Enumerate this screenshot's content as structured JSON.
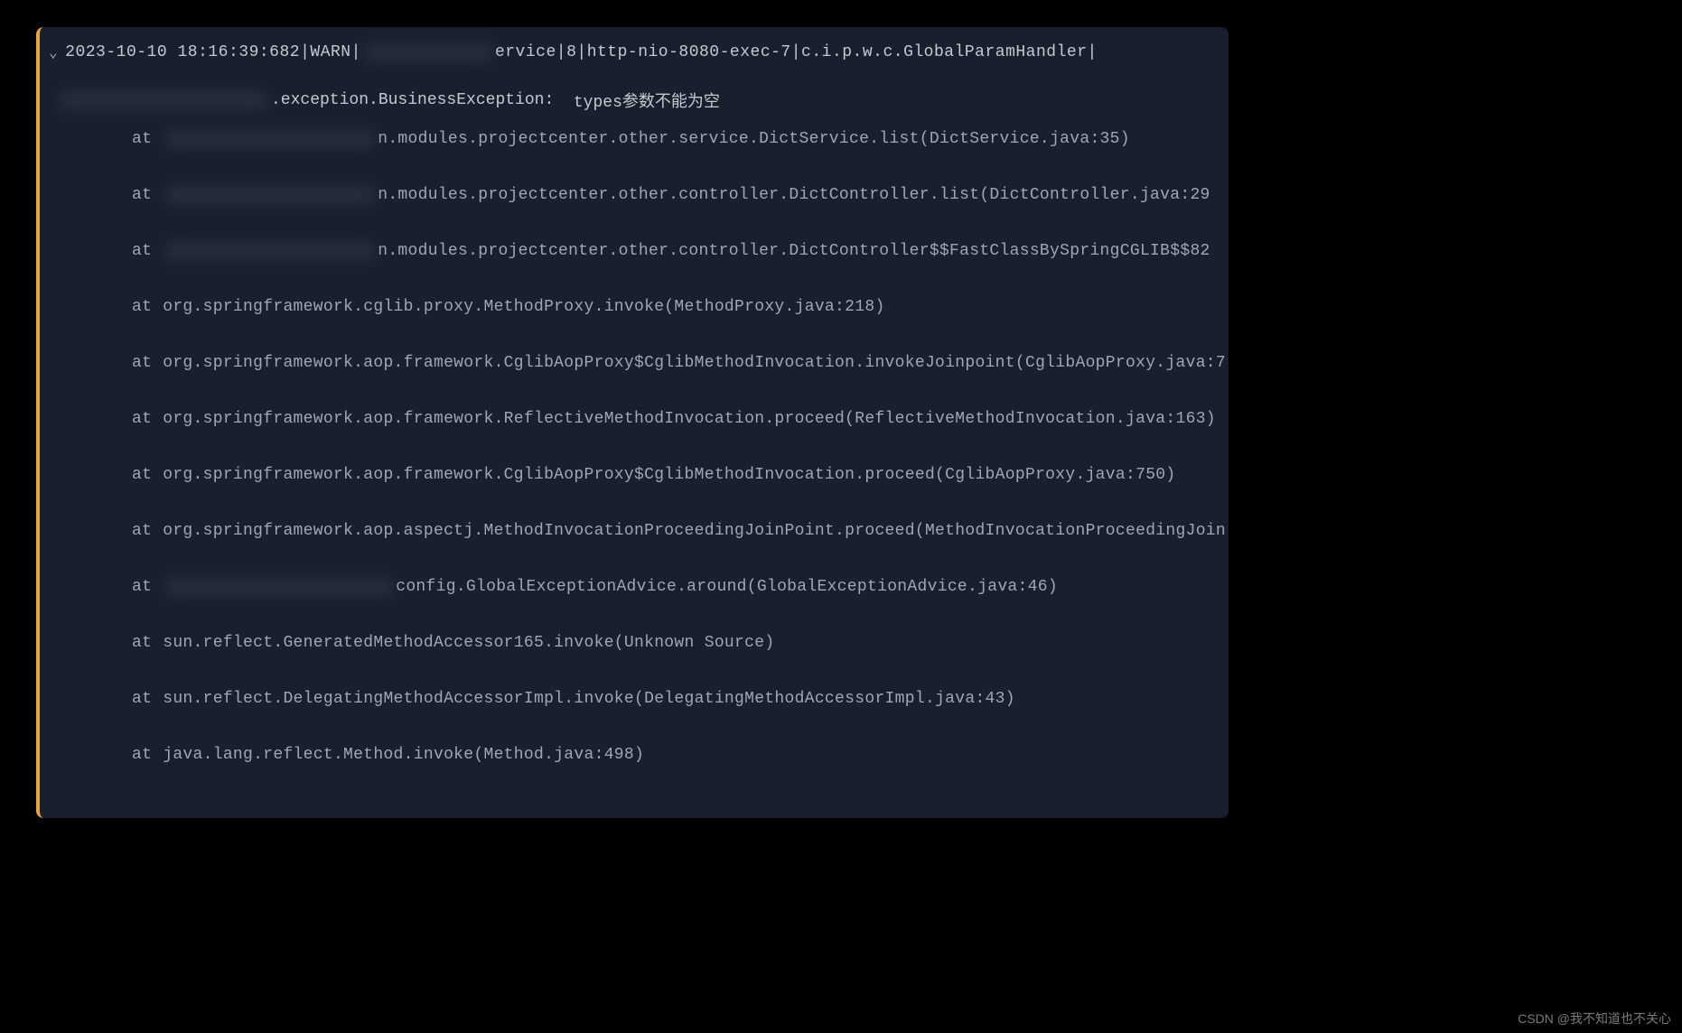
{
  "header": {
    "timestamp": "2023-10-10 18:16:39:682",
    "level": "WARN",
    "service_suffix": "ervice",
    "thread_id": "8",
    "thread_name": "http-nio-8080-exec-7",
    "logger": "c.i.p.w.c.GlobalParamHandler"
  },
  "exception": {
    "class_suffix": ".exception.BusinessException:",
    "message": "types参数不能为空"
  },
  "stack": [
    {
      "at": "at",
      "has_redaction": true,
      "text_suffix": "n.modules.projectcenter.other.service.DictService.list(DictService.java:35)"
    },
    {
      "at": "at",
      "has_redaction": true,
      "text_suffix": "n.modules.projectcenter.other.controller.DictController.list(DictController.java:29"
    },
    {
      "at": "at",
      "has_redaction": true,
      "text_suffix": "n.modules.projectcenter.other.controller.DictController$$FastClassBySpringCGLIB$$82"
    },
    {
      "at": "at",
      "has_redaction": false,
      "text": "org.springframework.cglib.proxy.MethodProxy.invoke(MethodProxy.java:218)"
    },
    {
      "at": "at",
      "has_redaction": false,
      "text": "org.springframework.aop.framework.CglibAopProxy$CglibMethodInvocation.invokeJoinpoint(CglibAopProxy.java:7"
    },
    {
      "at": "at",
      "has_redaction": false,
      "text": "org.springframework.aop.framework.ReflectiveMethodInvocation.proceed(ReflectiveMethodInvocation.java:163)"
    },
    {
      "at": "at",
      "has_redaction": false,
      "text": "org.springframework.aop.framework.CglibAopProxy$CglibMethodInvocation.proceed(CglibAopProxy.java:750)"
    },
    {
      "at": "at",
      "has_redaction": false,
      "text": "org.springframework.aop.aspectj.MethodInvocationProceedingJoinPoint.proceed(MethodInvocationProceedingJoin"
    },
    {
      "at": "at",
      "has_redaction": true,
      "redaction_class": "redacted-lg",
      "text_suffix": "config.GlobalExceptionAdvice.around(GlobalExceptionAdvice.java:46)"
    },
    {
      "at": "at",
      "has_redaction": false,
      "text": "sun.reflect.GeneratedMethodAccessor165.invoke(Unknown Source)"
    },
    {
      "at": "at",
      "has_redaction": false,
      "text": "sun.reflect.DelegatingMethodAccessorImpl.invoke(DelegatingMethodAccessorImpl.java:43)"
    },
    {
      "at": "at",
      "has_redaction": false,
      "text": "java.lang.reflect.Method.invoke(Method.java:498)"
    }
  ],
  "watermark": "CSDN @我不知道也不关心"
}
